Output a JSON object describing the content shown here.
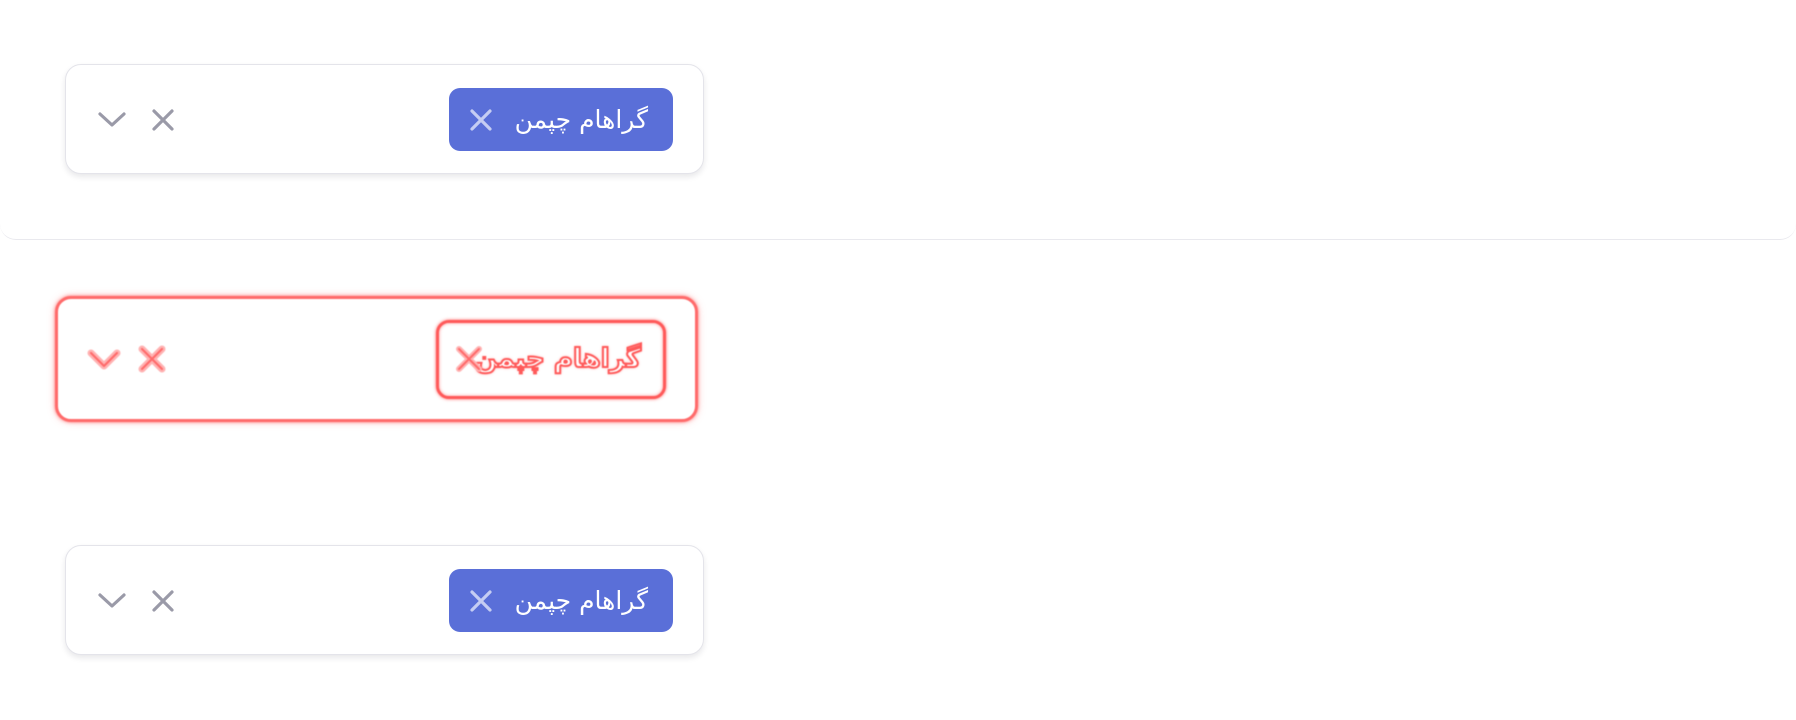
{
  "rows": [
    {
      "variant": "default",
      "selected_label": "گراهام چپمن",
      "chip_color": "#5a6fd8"
    },
    {
      "variant": "error",
      "selected_label": "گراهام چپمن",
      "outline_color": "#ff5a5a"
    },
    {
      "variant": "default",
      "selected_label": "گراهام چپمن",
      "chip_color": "#5a6fd8"
    }
  ],
  "icons": {
    "chip_remove": "close-icon",
    "clear": "close-icon",
    "dropdown": "chevron-down-icon"
  }
}
